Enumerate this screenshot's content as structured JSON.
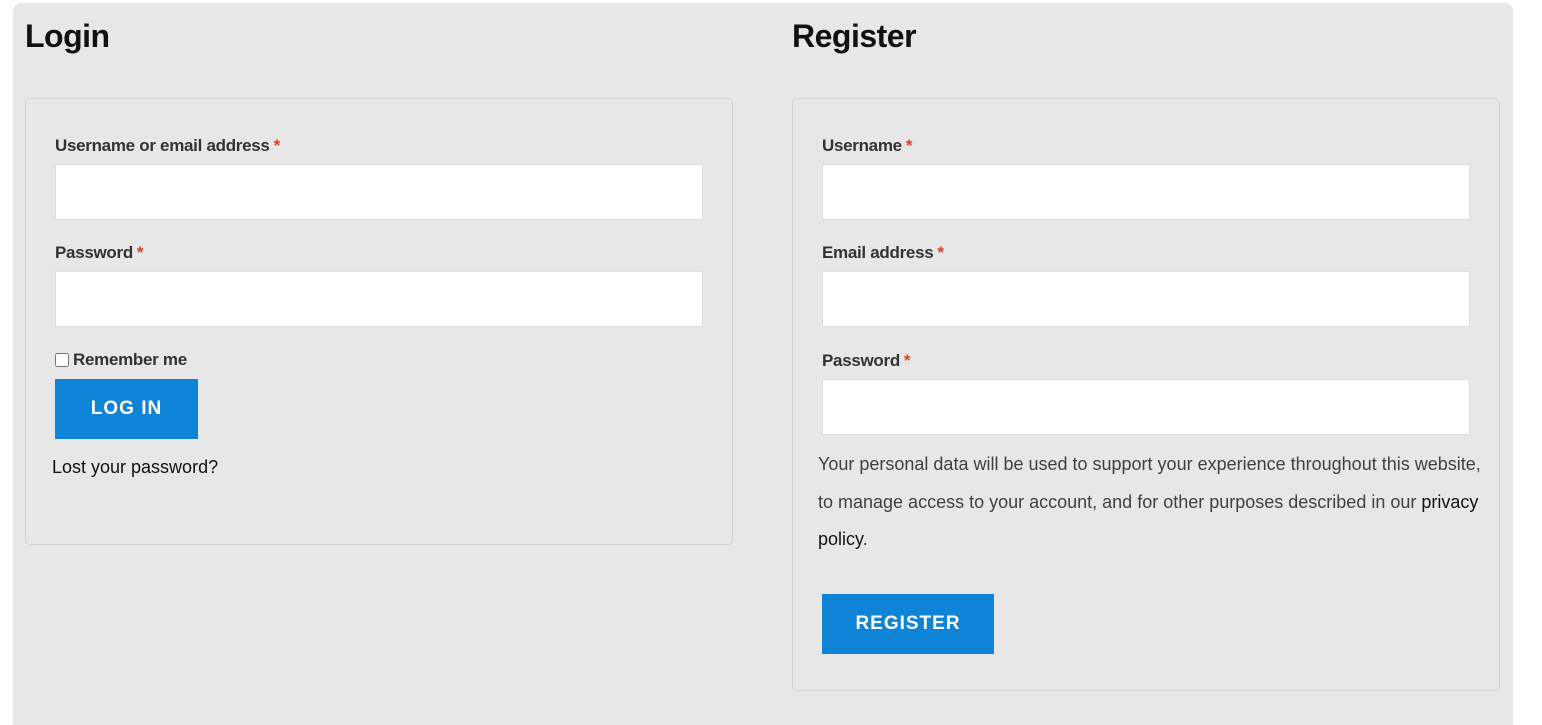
{
  "login": {
    "title": "Login",
    "username_label": "Username or email address",
    "password_label": "Password",
    "required_mark": "*",
    "remember_label": "Remember me",
    "submit_label": "LOG IN",
    "lost_password": "Lost your password?"
  },
  "register": {
    "title": "Register",
    "username_label": "Username",
    "email_label": "Email address",
    "password_label": "Password",
    "required_mark": "*",
    "privacy_text_before": "Your personal data will be used to support your experience throughout this website, to manage access to your account, and for other purposes described in our ",
    "privacy_link": "privacy policy",
    "privacy_text_after": ".",
    "submit_label": "REGISTER"
  },
  "colors": {
    "background": "#e7e7e7",
    "button": "#0f84d7",
    "required": "#e2401c"
  }
}
